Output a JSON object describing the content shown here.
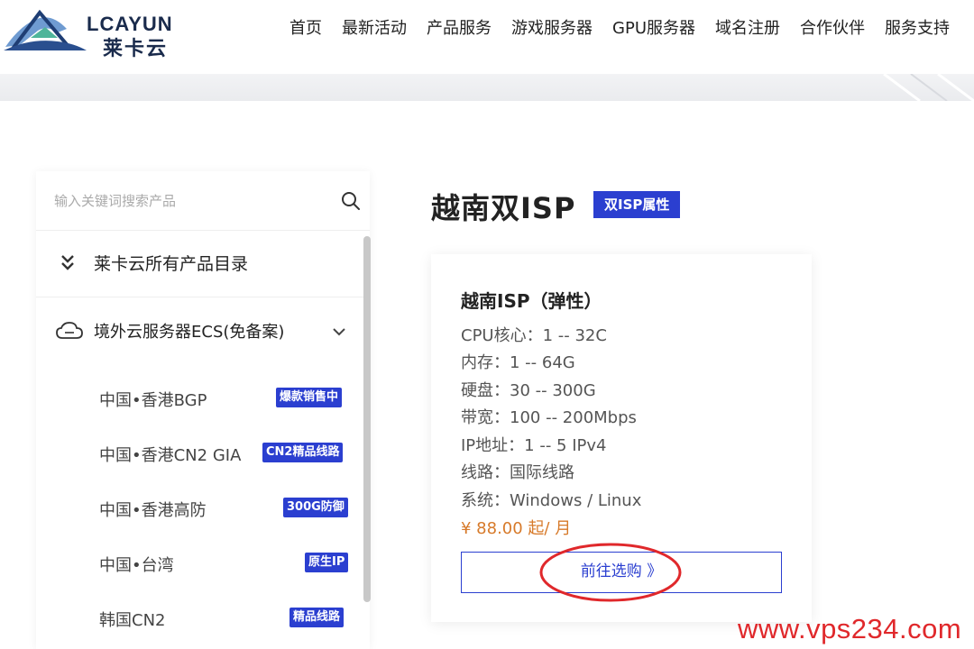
{
  "header": {
    "logo_text": "LCAYUN",
    "logo_cn": "莱卡云",
    "nav": [
      "首页",
      "最新活动",
      "产品服务",
      "游戏服务器",
      "GPU服务器",
      "域名注册",
      "合作伙伴",
      "服务支持"
    ]
  },
  "sidebar": {
    "search_placeholder": "输入关键词搜索产品",
    "catalog_label": "莱卡云所有产品目录",
    "section_label": "境外云服务器ECS(免备案)",
    "items": [
      {
        "label": "中国•香港BGP",
        "badge": "爆款销售中"
      },
      {
        "label": "中国•香港CN2 GIA",
        "badge": "CN2精品线路"
      },
      {
        "label": "中国•香港高防",
        "badge": "300G防御"
      },
      {
        "label": "中国•台湾",
        "badge": "原生IP"
      },
      {
        "label": "韩国CN2",
        "badge": "精品线路"
      }
    ]
  },
  "main": {
    "title": "越南双ISP",
    "title_badge": "双ISP属性",
    "card": {
      "title": "越南ISP（弹性）",
      "specs": [
        "CPU核心：1 -- 32C",
        "内存：1 -- 64G",
        "硬盘：30 -- 300G",
        "带宽：100 -- 200Mbps",
        "IP地址：1 -- 5 IPv4",
        "线路：国际线路",
        "系统：Windows / Linux"
      ],
      "price": "¥ 88.00 起/ 月",
      "buy_label": "前往选购 》"
    }
  },
  "watermark": "www.vps234.com",
  "colors": {
    "accent": "#2b3fd0",
    "price": "#d77a2a",
    "watermark": "#e0282b"
  }
}
